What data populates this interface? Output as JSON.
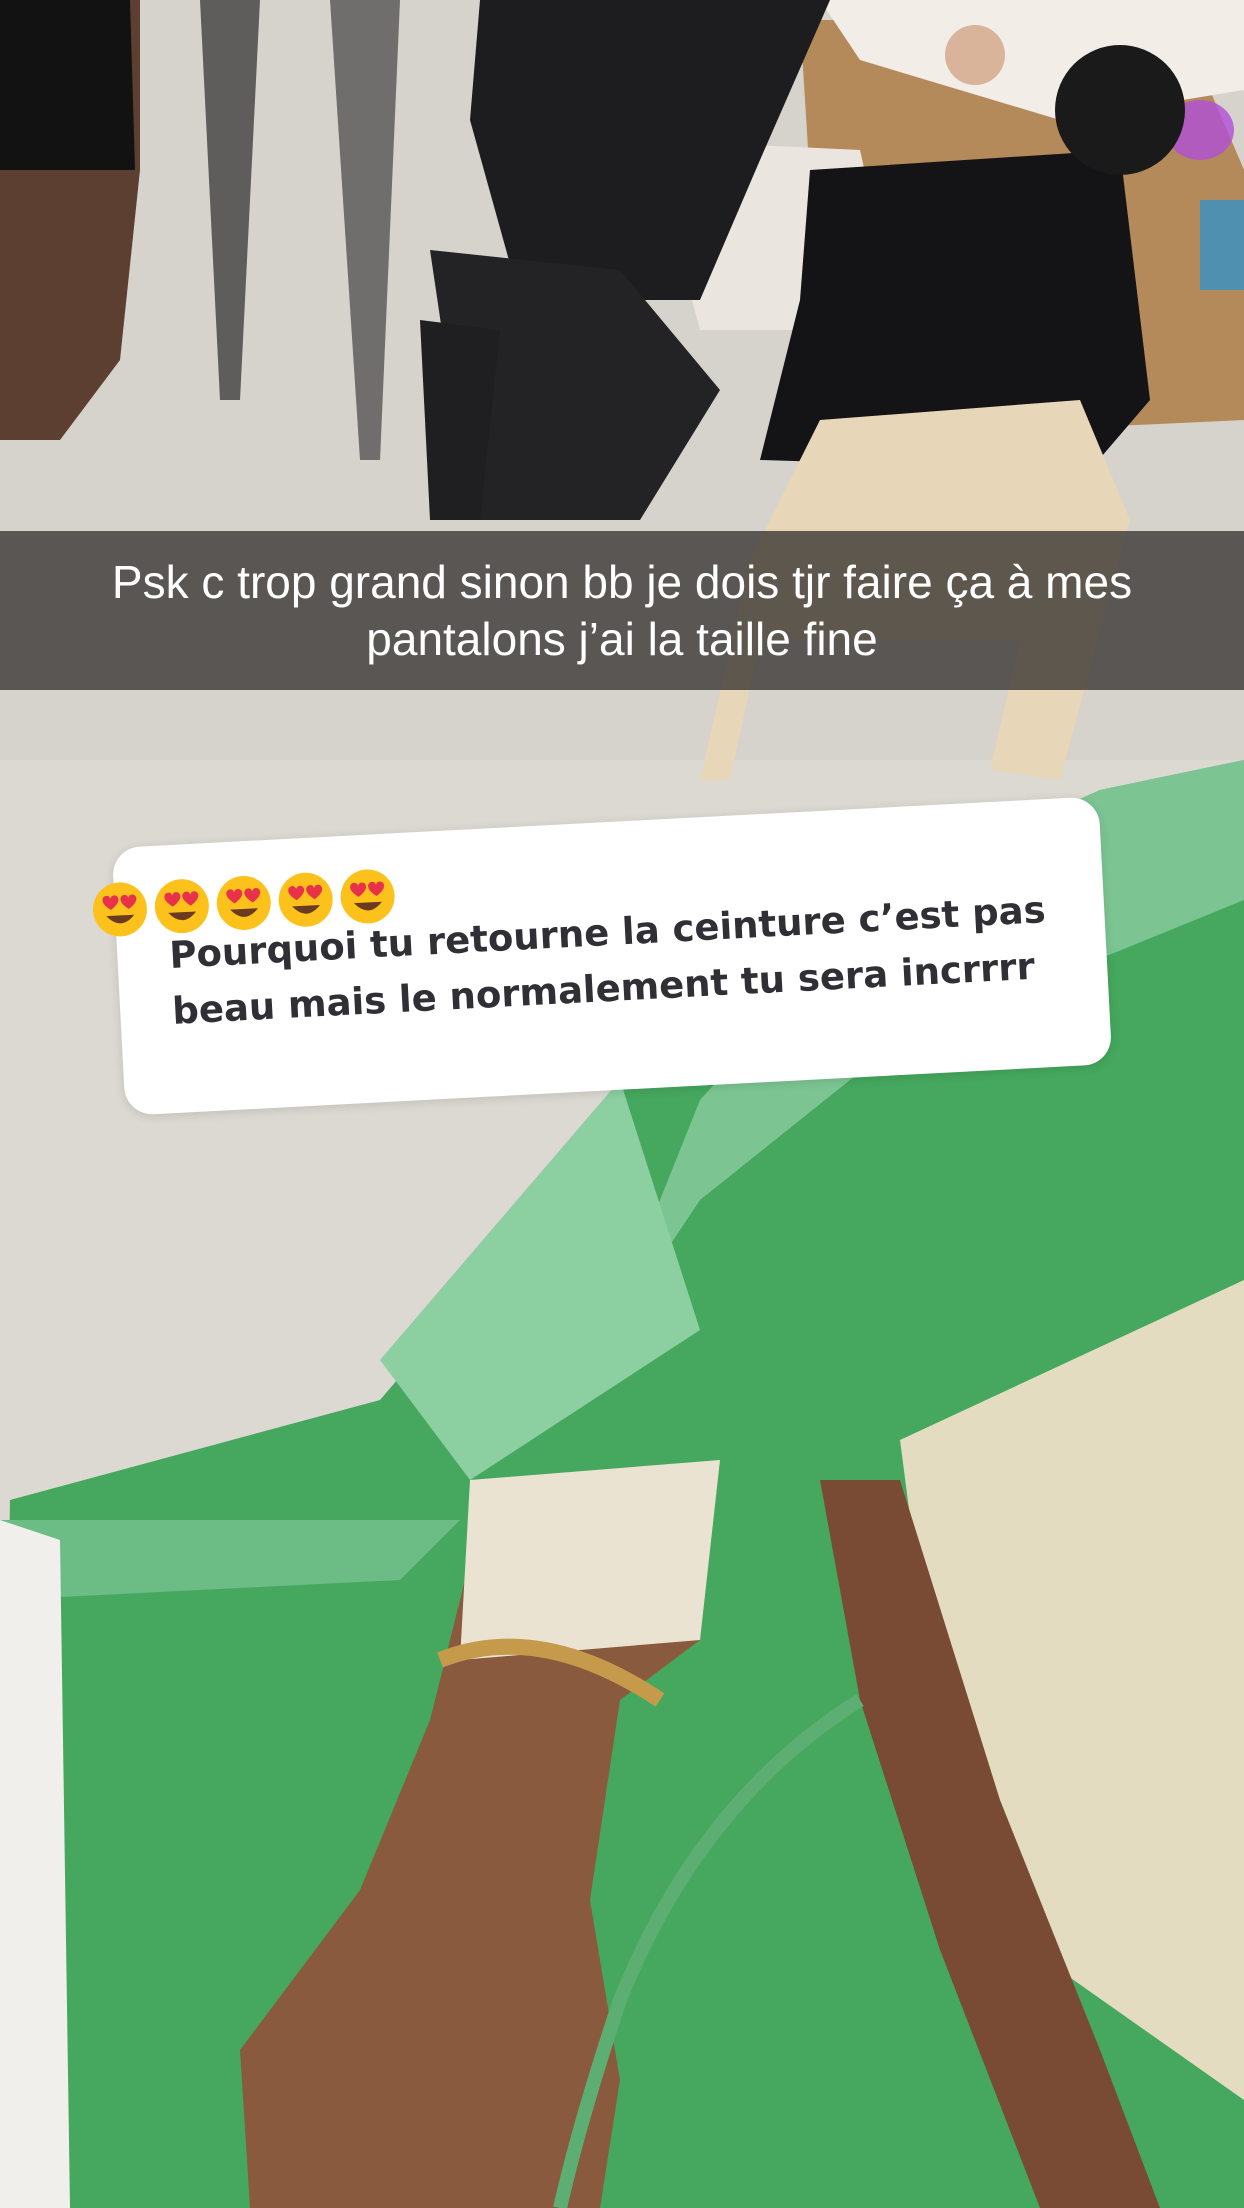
{
  "story": {
    "caption": "Psk c trop grand sinon bb je dois tjr faire ça à mes pantalons j’ai la taille fine",
    "reply": {
      "emoji_icons": [
        "heart-eyes-emoji",
        "heart-eyes-emoji",
        "heart-eyes-emoji",
        "heart-eyes-emoji",
        "heart-eyes-emoji"
      ],
      "text": "Pourquoi tu retourne la ceinture c’est pas beau mais le normalement tu sera incrrrr"
    }
  },
  "colors": {
    "caption_bar": "#282624",
    "caption_text": "#ffffff",
    "reply_bg": "#ffffff",
    "reply_text": "#2f2f35",
    "jacket_green": "#3fa65a",
    "jacket_mint": "#86c99a",
    "floor": "#d9d5cf"
  }
}
